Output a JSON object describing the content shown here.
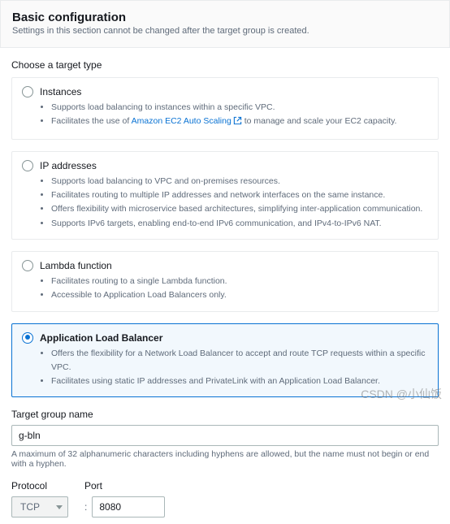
{
  "header": {
    "title": "Basic configuration",
    "subtitle": "Settings in this section cannot be changed after the target group is created."
  },
  "targetType": {
    "label": "Choose a target type",
    "options": [
      {
        "id": "instances",
        "title": "Instances",
        "selected": false,
        "bullets": [
          {
            "text": "Supports load balancing to instances within a specific VPC."
          },
          {
            "prefix": "Facilitates the use of ",
            "link_text": "Amazon EC2 Auto Scaling",
            "suffix": " to manage and scale your EC2 capacity.",
            "has_link": true
          }
        ]
      },
      {
        "id": "ip-addresses",
        "title": "IP addresses",
        "selected": false,
        "bullets": [
          {
            "text": "Supports load balancing to VPC and on-premises resources."
          },
          {
            "text": "Facilitates routing to multiple IP addresses and network interfaces on the same instance."
          },
          {
            "text": "Offers flexibility with microservice based architectures, simplifying inter-application communication."
          },
          {
            "text": "Supports IPv6 targets, enabling end-to-end IPv6 communication, and IPv4-to-IPv6 NAT."
          }
        ]
      },
      {
        "id": "lambda-function",
        "title": "Lambda function",
        "selected": false,
        "bullets": [
          {
            "text": "Facilitates routing to a single Lambda function."
          },
          {
            "text": "Accessible to Application Load Balancers only."
          }
        ]
      },
      {
        "id": "alb",
        "title": "Application Load Balancer",
        "selected": true,
        "bullets": [
          {
            "text": "Offers the flexibility for a Network Load Balancer to accept and route TCP requests within a specific VPC."
          },
          {
            "text": "Facilitates using static IP addresses and PrivateLink with an Application Load Balancer."
          }
        ]
      }
    ]
  },
  "targetGroupName": {
    "label": "Target group name",
    "value": "g-bln",
    "helper": "A maximum of 32 alphanumeric characters including hyphens are allowed, but the name must not begin or end with a hyphen."
  },
  "protocolPort": {
    "protocol_label": "Protocol",
    "protocol_value": "TCP",
    "port_label": "Port",
    "port_value": "8080",
    "separator": ":"
  },
  "watermark": "CSDN @小仙饭"
}
